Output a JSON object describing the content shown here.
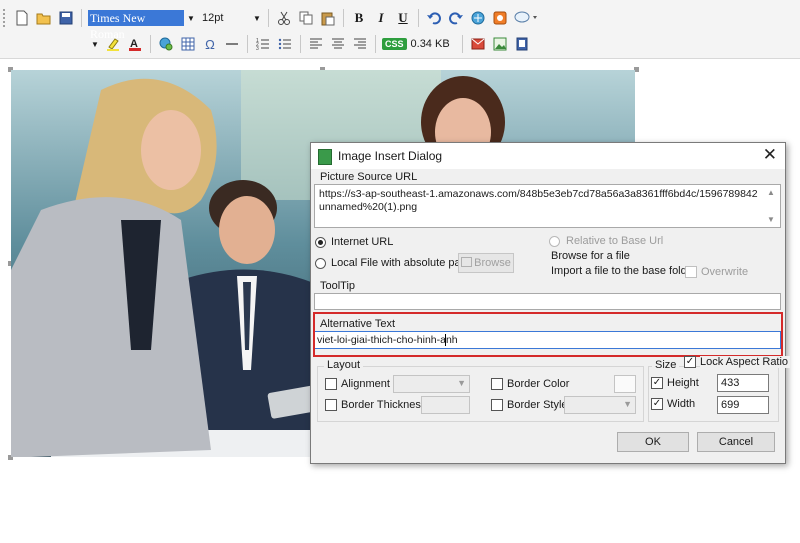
{
  "toolbar": {
    "font_name": "Times New Roman",
    "font_size": "12pt",
    "bold": "B",
    "italic": "I",
    "underline": "U",
    "css_badge": "CSS",
    "doc_size": "0.34 KB",
    "icons": [
      "new-icon",
      "open-icon",
      "save-icon",
      "cut-icon",
      "copy-icon",
      "paste-icon",
      "undo-icon",
      "redo-icon",
      "link-icon",
      "insert-image-icon",
      "comment-icon",
      "highlight-icon",
      "font-color-icon",
      "hyperlink-icon",
      "table-icon",
      "omega-icon",
      "horizontal-rule-icon",
      "numbered-list-icon",
      "bullet-list-icon",
      "align-left-icon",
      "align-center-icon",
      "align-right-icon",
      "email-icon",
      "picture-icon",
      "page-icon"
    ]
  },
  "dialog": {
    "title": "Image Insert Dialog",
    "close": "✕",
    "source_url_label": "Picture Source URL",
    "source_url": "https://s3-ap-southeast-1.amazonaws.com/848b5e3eb7cd78a56a3a8361fff6bd4c/1596789842unnamed%20(1).png",
    "radio_internet": "Internet URL",
    "radio_local": "Local File with absolute path",
    "browse_button": "Browse",
    "radio_relative": "Relative to Base Url",
    "browse_for_file": "Browse for a file",
    "import_file": "Import a file to the base folder",
    "overwrite": "Overwrite",
    "tooltip_label": "ToolTip",
    "tooltip_value": "",
    "alt_text_label": "Alternative Text",
    "alt_text_value": "viet-loi-giai-thich-cho-hinh-anh",
    "layout_legend": "Layout",
    "alignment": "Alignment",
    "border_thickness": "Border Thickness",
    "border_color": "Border Color",
    "border_style": "Border Style",
    "size_legend": "Size",
    "lock_aspect": "Lock Aspect Ratio",
    "height_label": "Height",
    "height_value": "433",
    "width_label": "Width",
    "width_value": "699",
    "ok": "OK",
    "cancel": "Cancel"
  },
  "colors": {
    "accent_selection": "#3b78d7",
    "highlight_border": "#d42a2a",
    "css_badge": "#2e9e3e"
  }
}
